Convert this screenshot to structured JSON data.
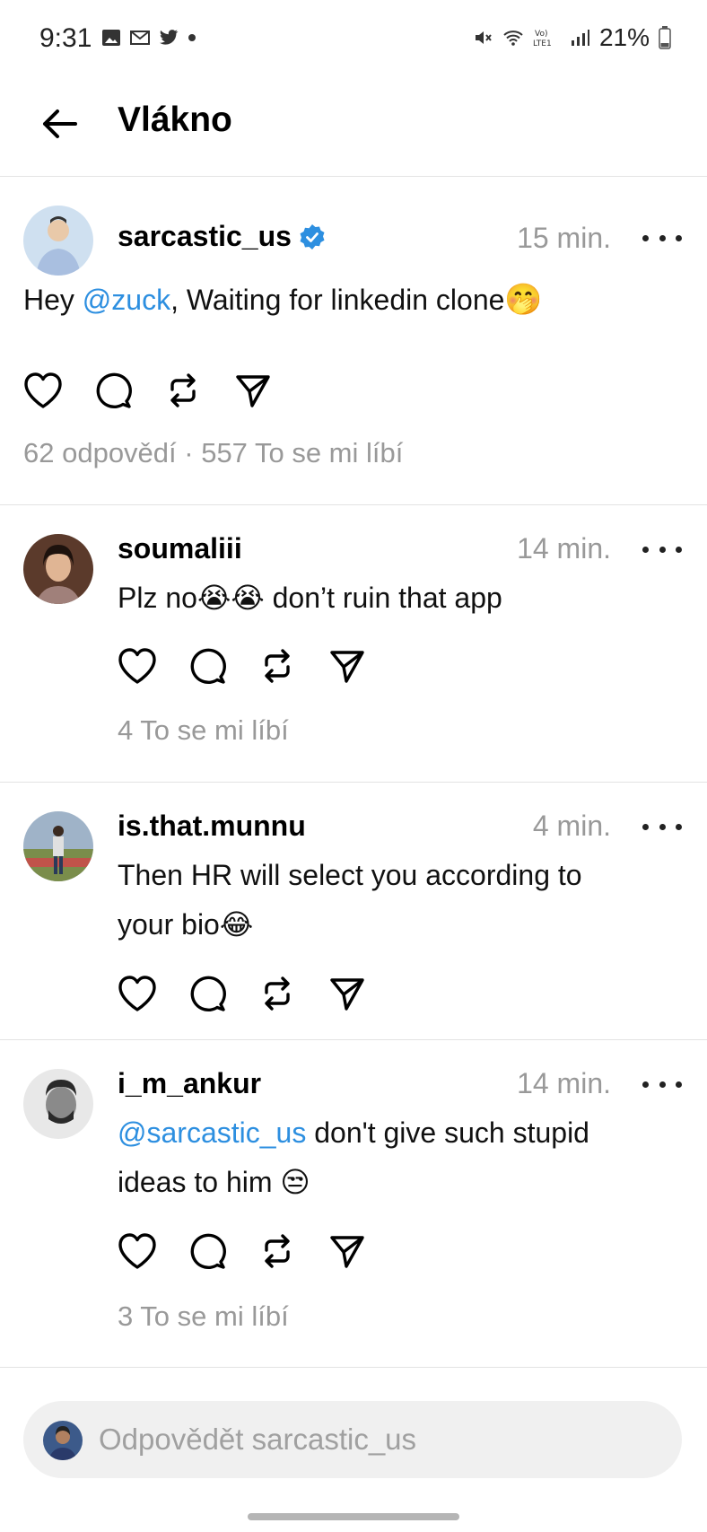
{
  "status_bar": {
    "time": "9:31",
    "battery": "21%"
  },
  "header": {
    "title": "Vlákno"
  },
  "main_post": {
    "username": "sarcastic_us",
    "time": "15 min.",
    "text_before": "Hey ",
    "mention": "@zuck",
    "text_after": ", Waiting for linkedin clone",
    "emoji": "🤭",
    "stats": "62 odpovědí · 557 To se mi líbí"
  },
  "replies": [
    {
      "username": "soumaliii",
      "time": "14 min.",
      "text": "Plz no😭😭 don’t ruin that app",
      "stats": "4 To se mi líbí"
    },
    {
      "username": "is.that.munnu",
      "time": "4 min.",
      "text_line1": "Then HR will select you  according to",
      "text_line2": "your bio😂"
    },
    {
      "username": "i_m_ankur",
      "time": "14 min.",
      "mention": "@sarcastic_us",
      "text_line1_after": " don't give such stupid",
      "text_line2": "ideas to him 😒",
      "stats": "3 To se mi líbí"
    }
  ],
  "reply_bar": {
    "placeholder": "Odpovědět sarcastic_us"
  },
  "colors": {
    "accent": "#2d8fe0",
    "muted": "#999999",
    "divider": "#e3e3e3"
  }
}
